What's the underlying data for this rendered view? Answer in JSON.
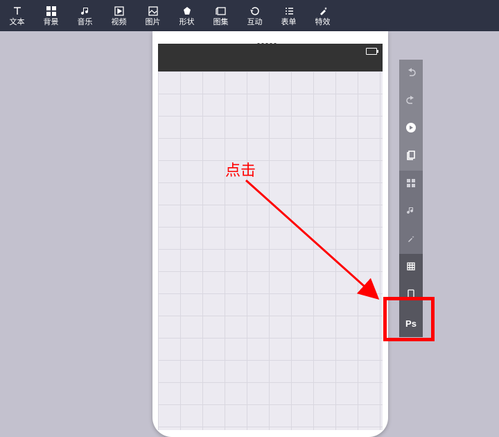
{
  "toolbar": {
    "items": [
      {
        "id": "text",
        "label": "文本"
      },
      {
        "id": "bg",
        "label": "背景"
      },
      {
        "id": "music",
        "label": "音乐"
      },
      {
        "id": "video",
        "label": "视频"
      },
      {
        "id": "image",
        "label": "图片"
      },
      {
        "id": "shape",
        "label": "形状"
      },
      {
        "id": "gallery",
        "label": "图集"
      },
      {
        "id": "interact",
        "label": "互动"
      },
      {
        "id": "form",
        "label": "表单"
      },
      {
        "id": "effect",
        "label": "特效"
      }
    ]
  },
  "sidebar": {
    "items": [
      {
        "id": "undo"
      },
      {
        "id": "redo"
      },
      {
        "id": "play"
      },
      {
        "id": "pages"
      },
      {
        "id": "grid4"
      },
      {
        "id": "music"
      },
      {
        "id": "effects"
      },
      {
        "id": "gridtoggle"
      },
      {
        "id": "device"
      },
      {
        "id": "ps",
        "label": "Ps"
      }
    ]
  },
  "annotation": {
    "label": "点击"
  },
  "colors": {
    "accent_red": "#ff0000",
    "toolbar_bg": "#2e3344"
  }
}
